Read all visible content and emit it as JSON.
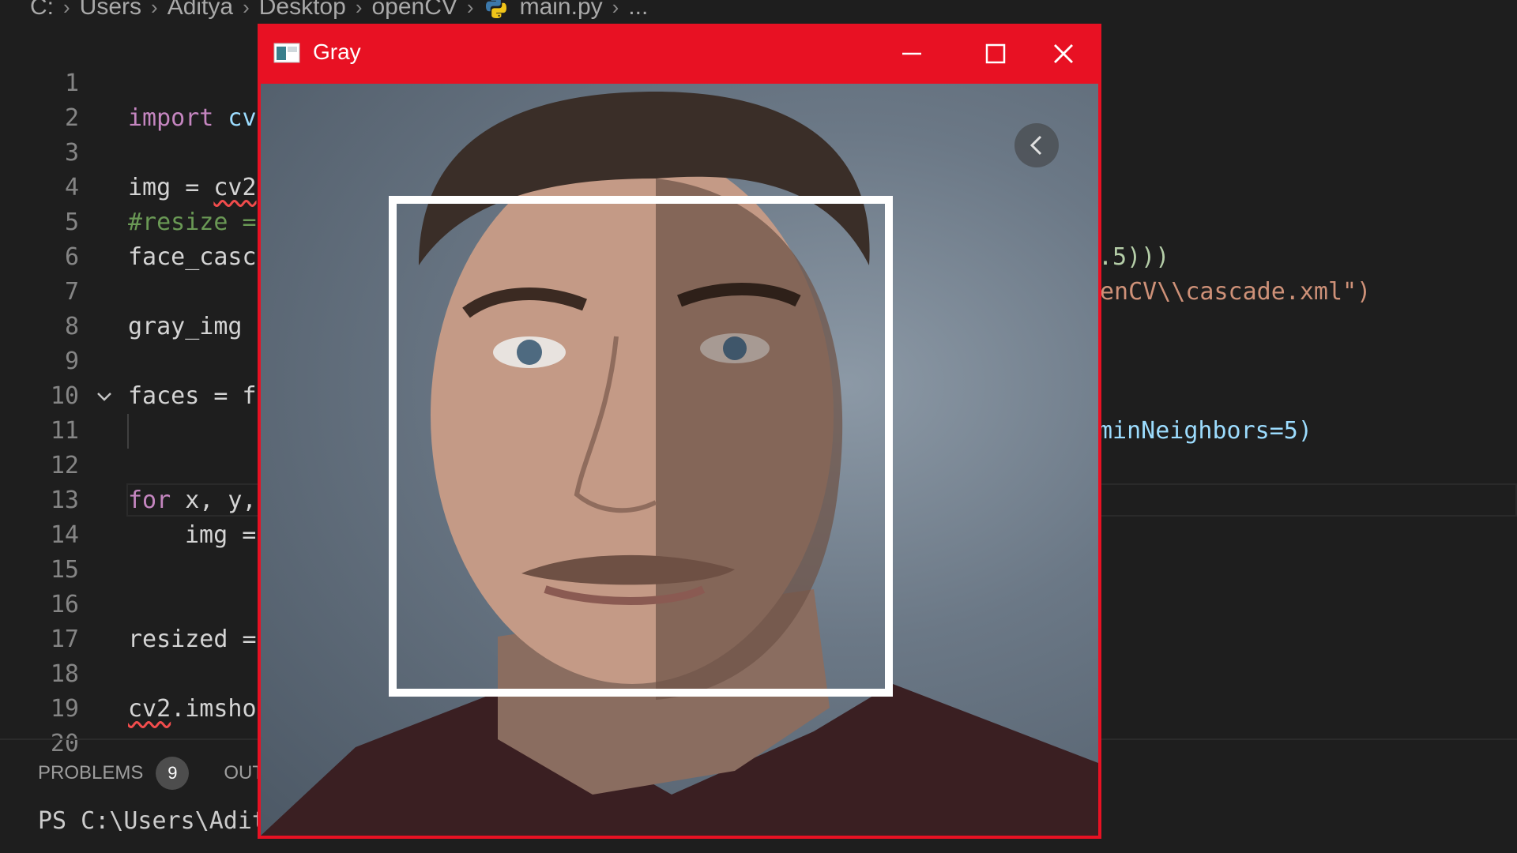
{
  "breadcrumb": {
    "items": [
      "C:",
      "Users",
      "Aditya",
      "Desktop",
      "openCV",
      "main.py",
      "..."
    ]
  },
  "editor": {
    "lines": [
      {
        "num": "1"
      },
      {
        "num": "2"
      },
      {
        "num": "3"
      },
      {
        "num": "4"
      },
      {
        "num": "5"
      },
      {
        "num": "6"
      },
      {
        "num": "7"
      },
      {
        "num": "8"
      },
      {
        "num": "9"
      },
      {
        "num": "10"
      },
      {
        "num": "11"
      },
      {
        "num": "12"
      },
      {
        "num": "13"
      },
      {
        "num": "14"
      },
      {
        "num": "15"
      },
      {
        "num": "16"
      },
      {
        "num": "17"
      },
      {
        "num": "18"
      },
      {
        "num": "19"
      },
      {
        "num": "20"
      }
    ],
    "code": {
      "l1_kw": "import",
      "l1_rest": " cv",
      "l3_a": "img",
      "l3_b": " = ",
      "l3_c": "cv2",
      "l4": "#resize =",
      "l5": "face_casc",
      "l7": "gray_img",
      "l9_a": "faces",
      "l9_b": " = f",
      "l11_kw": "for",
      "l11_rest": " x, y,",
      "l12": "img =",
      "l16": "resized =",
      "l18_a": "cv2",
      "l18_b": ".imsho",
      "r4": ".5)))",
      "r5": "enCV\\\\cascade.xml\")",
      "r9": "minNeighbors=5)"
    }
  },
  "panel": {
    "problems_label": "PROBLEMS",
    "problems_count": "9",
    "output_label": "OUT",
    "terminal_text": "PS C:\\Users\\Adity"
  },
  "window": {
    "title": "Gray",
    "accent": "#e81123",
    "minimize_icon": "minimize-icon",
    "maximize_icon": "maximize-icon",
    "close_icon": "close-icon",
    "nav_icon": "chevron-left-icon"
  }
}
